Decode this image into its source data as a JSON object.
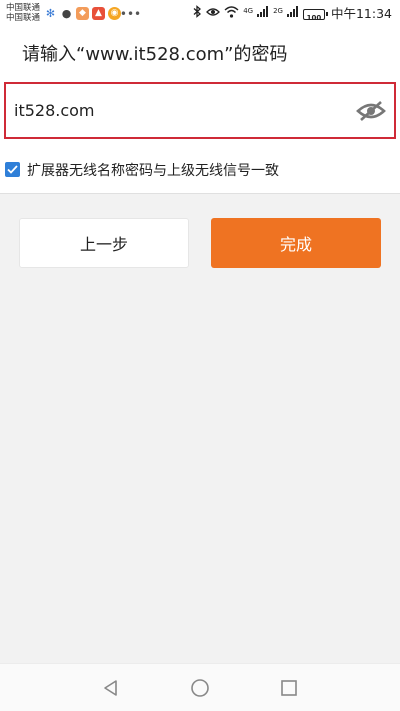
{
  "status_bar": {
    "carrier_1": "中国联通",
    "carrier_2": "中国联通",
    "network_4g": "4G",
    "network_2g": "2G",
    "battery": "100",
    "time": "中午11:34"
  },
  "header": {
    "title": "请输入“www.it528.com”的密码"
  },
  "password_field": {
    "value": "it528.com"
  },
  "sync_option": {
    "checked": true,
    "label": "扩展器无线名称密码与上级无线信号一致"
  },
  "buttons": {
    "prev_label": "上一步",
    "done_label": "完成"
  },
  "colors": {
    "accent_orange": "#ef7322",
    "field_border_red": "#cf2a37",
    "checkbox_blue": "#2f7fd8"
  },
  "icons": {
    "eye": "eye-slash-icon",
    "nav_back": "triangle-back-icon",
    "nav_home": "circle-home-icon",
    "nav_recent": "square-recent-icon"
  }
}
